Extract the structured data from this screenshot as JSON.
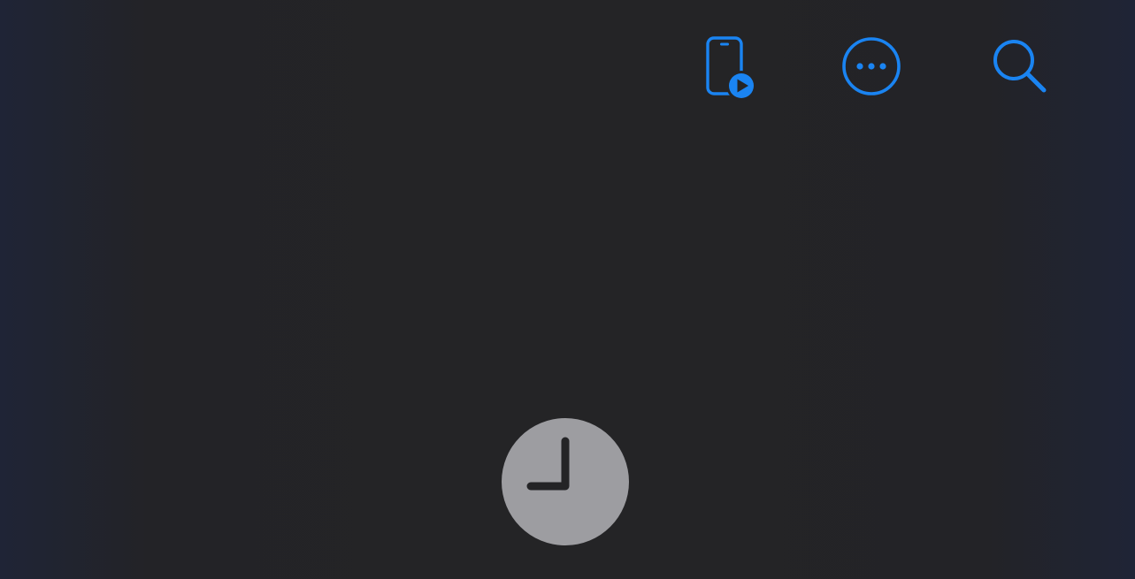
{
  "colors": {
    "background": "#242426",
    "edge_tint": "#1f2436",
    "accent": "#1a84f2",
    "clock_fill": "#9d9da1",
    "clock_hands": "#242426"
  },
  "toolbar": {
    "mirror_button": {
      "icon": "iphone-mirroring-icon"
    },
    "more_button": {
      "icon": "ellipsis-circle-icon"
    },
    "search_button": {
      "icon": "magnifying-glass-icon"
    }
  },
  "empty_state": {
    "icon": "clock-icon"
  }
}
